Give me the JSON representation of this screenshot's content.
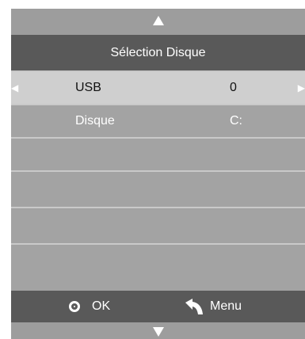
{
  "nav": {
    "up_icon": "triangle-up-icon",
    "down_icon": "triangle-down-icon"
  },
  "header": {
    "title": "Sélection Disque"
  },
  "list": {
    "items": [
      {
        "label": "USB",
        "value": "0",
        "selected": true
      },
      {
        "label": "Disque",
        "value": "C:",
        "selected": false
      }
    ],
    "empty_rows": 4
  },
  "footer": {
    "ok_icon": "circle-dot-icon",
    "ok_label": "OK",
    "menu_icon": "return-arrow-icon",
    "menu_label": "Menu"
  },
  "colors": {
    "panel": "#a3a3a3",
    "bar": "#595959",
    "selected": "#cfcfcf"
  }
}
